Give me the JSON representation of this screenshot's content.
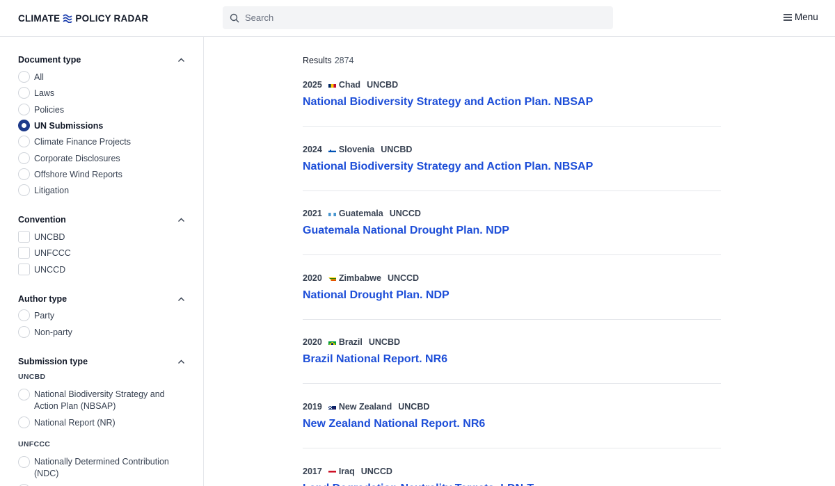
{
  "header": {
    "logo_left": "CLIMATE",
    "logo_right": "POLICY RADAR",
    "search_placeholder": "Search",
    "menu_label": "Menu"
  },
  "sidebar": {
    "document_type": {
      "title": "Document type",
      "options": [
        "All",
        "Laws",
        "Policies",
        "UN Submissions",
        "Climate Finance Projects",
        "Corporate Disclosures",
        "Offshore Wind Reports",
        "Litigation"
      ],
      "selected": "UN Submissions"
    },
    "convention": {
      "title": "Convention",
      "options": [
        "UNCBD",
        "UNFCCC",
        "UNCCD"
      ]
    },
    "author_type": {
      "title": "Author type",
      "options": [
        "Party",
        "Non-party"
      ]
    },
    "submission_type": {
      "title": "Submission type",
      "groups": [
        {
          "name": "UNCBD",
          "options": [
            "National Biodiversity Strategy and Action Plan (NBSAP)",
            "National Report (NR)"
          ]
        },
        {
          "name": "UNFCCC",
          "options": [
            "Nationally Determined Contribution (NDC)"
          ]
        }
      ]
    }
  },
  "results": {
    "label": "Results",
    "count": "2874",
    "items": [
      {
        "year": "2025",
        "country": "Chad",
        "flag": "chad",
        "convention": "UNCBD",
        "title": "National Biodiversity Strategy and Action Plan. NBSAP"
      },
      {
        "year": "2024",
        "country": "Slovenia",
        "flag": "slovenia",
        "convention": "UNCBD",
        "title": "National Biodiversity Strategy and Action Plan. NBSAP"
      },
      {
        "year": "2021",
        "country": "Guatemala",
        "flag": "guatemala",
        "convention": "UNCCD",
        "title": "Guatemala National Drought Plan. NDP"
      },
      {
        "year": "2020",
        "country": "Zimbabwe",
        "flag": "zimbabwe",
        "convention": "UNCCD",
        "title": "National Drought Plan. NDP"
      },
      {
        "year": "2020",
        "country": "Brazil",
        "flag": "brazil",
        "convention": "UNCBD",
        "title": "Brazil National Report. NR6"
      },
      {
        "year": "2019",
        "country": "New Zealand",
        "flag": "new-zealand",
        "convention": "UNCBD",
        "title": "New Zealand National Report. NR6"
      },
      {
        "year": "2017",
        "country": "Iraq",
        "flag": "iraq",
        "convention": "UNCCD",
        "title": "Land Degradation Neutrality Targets. LDN-T"
      }
    ]
  },
  "colors": {
    "accent": "#1e3a8a",
    "link": "#1d4ed8"
  }
}
